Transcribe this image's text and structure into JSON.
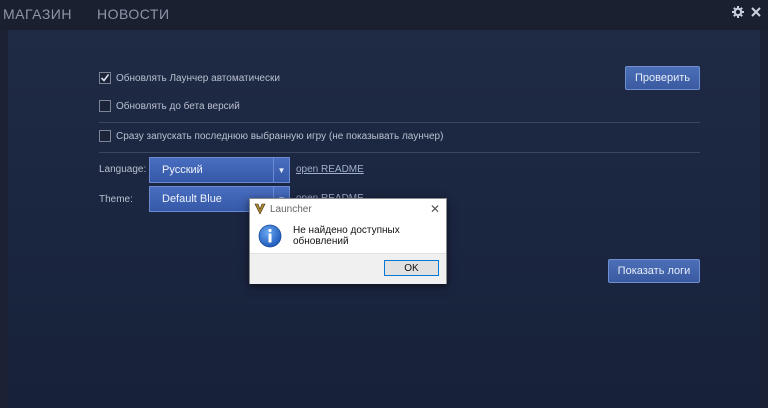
{
  "nav": {
    "store": "МАГАЗИН",
    "news": "НОВОСТИ"
  },
  "icons": {
    "settings": "gear-icon",
    "close": "close-icon"
  },
  "settings": {
    "auto_update": {
      "label": "Обновлять Лаунчер автоматически",
      "checked": true
    },
    "beta_update": {
      "label": "Обновлять до бета версий",
      "checked": false
    },
    "launch_last": {
      "label": "Сразу запускать последнюю выбранную игру (не показывать лаунчер)",
      "checked": false
    },
    "check_button": "Проверить",
    "language_label": "Language:",
    "language_value": "Русский",
    "language_link": "open README",
    "theme_label": "Theme:",
    "theme_value": "Default Blue",
    "theme_link": "open README",
    "logs_button": "Показать логи"
  },
  "dialog": {
    "title": "Launcher",
    "message": "Не найдено доступных обновлений",
    "ok": "OK"
  },
  "colors": {
    "accent": "#3a5aa0",
    "background": "#1b2233"
  }
}
